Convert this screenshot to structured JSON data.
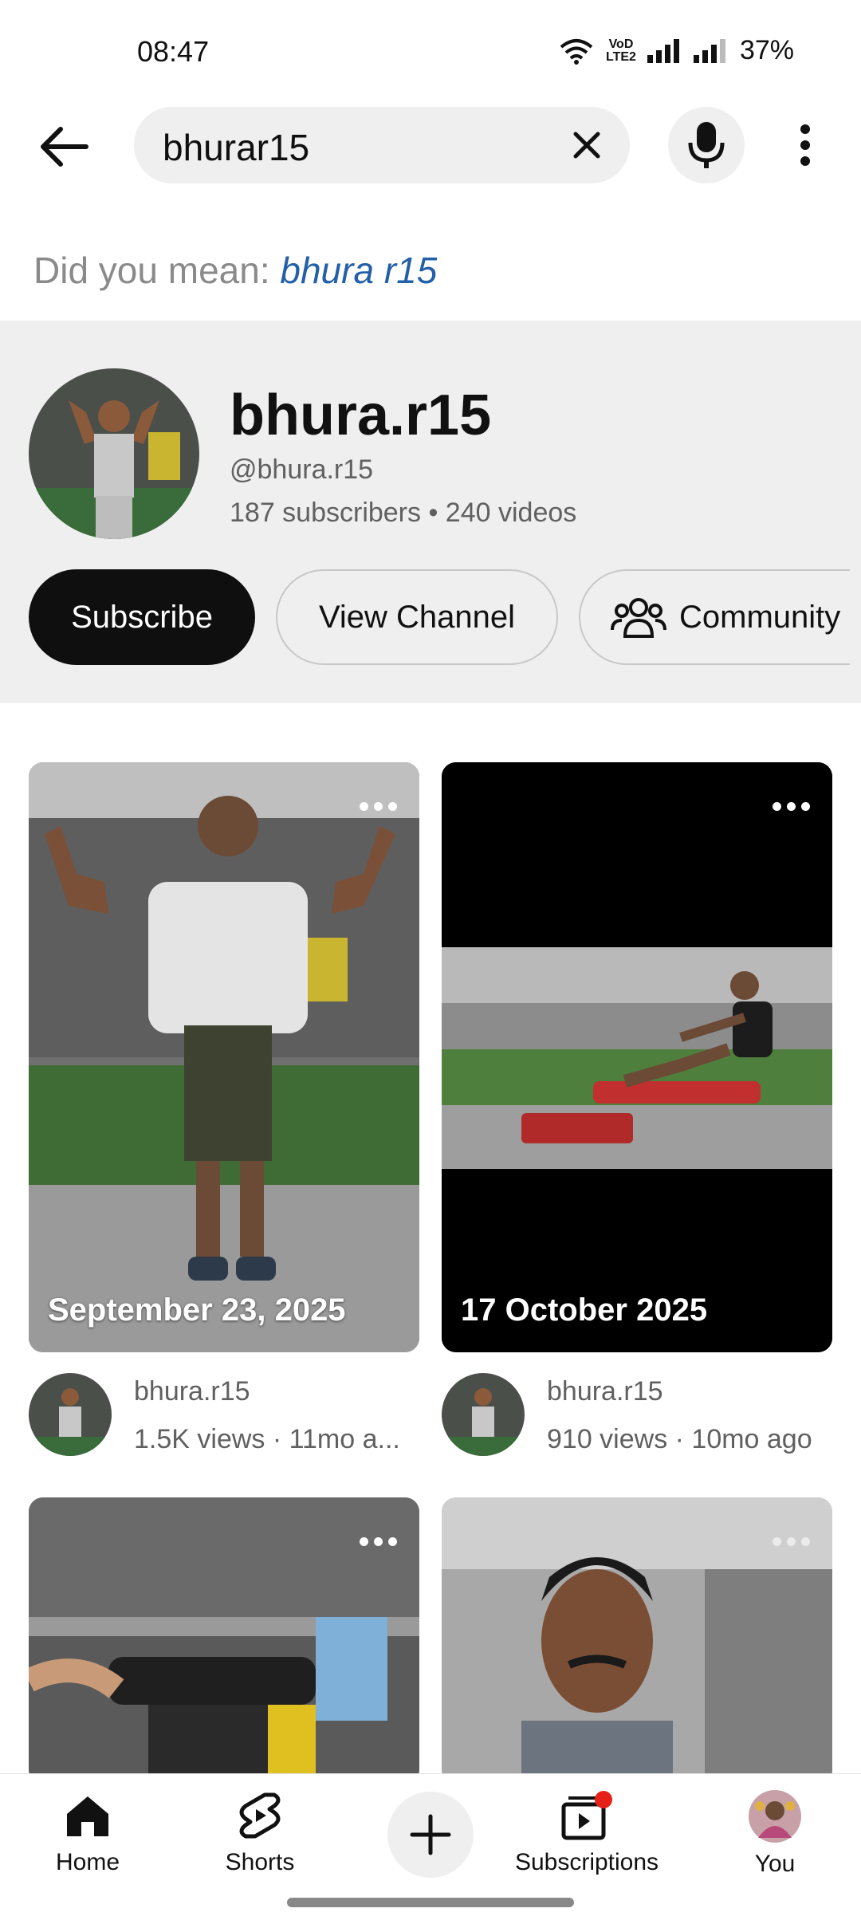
{
  "status_bar": {
    "time": "08:47",
    "volte_top": "VoLTE",
    "volte_a": "VoD",
    "volte_b": "LTE2",
    "battery": "37%"
  },
  "search": {
    "query": "bhurar15"
  },
  "did_you_mean": {
    "prefix": "Did you mean: ",
    "suggestion": "bhura r15"
  },
  "channel": {
    "name": "bhura.r15",
    "handle": "@bhura.r15",
    "stats": "187 subscribers • 240 videos",
    "subscribe_label": "Subscribe",
    "view_channel_label": "View Channel",
    "community_label": "Community"
  },
  "videos": [
    {
      "date": "September 23, 2025",
      "channel": "bhura.r15",
      "meta": "1.5K views · 11mo a..."
    },
    {
      "date": "17 October 2025",
      "channel": "bhura.r15",
      "meta": "910 views · 10mo ago"
    },
    {
      "date": "",
      "channel": "",
      "meta": ""
    },
    {
      "date": "",
      "channel": "",
      "meta": ""
    }
  ],
  "bottom_nav": {
    "home": "Home",
    "shorts": "Shorts",
    "subscriptions": "Subscriptions",
    "you": "You"
  },
  "colors": {
    "accent_link": "#2460a8",
    "subscribe_bg": "#0f0f0f",
    "notification_dot": "#e62117"
  }
}
